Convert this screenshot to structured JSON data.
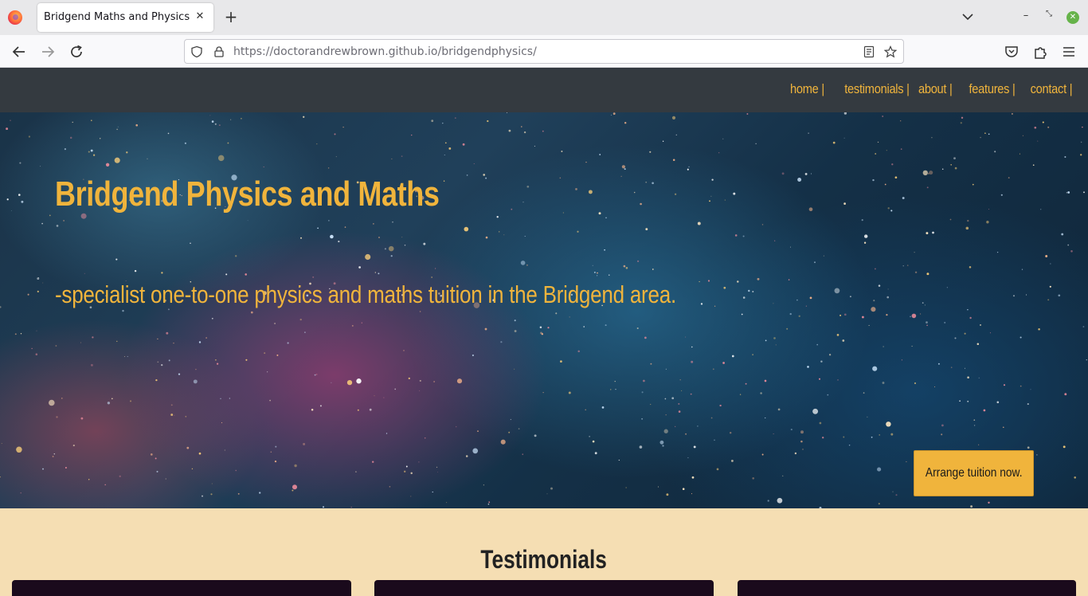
{
  "browser": {
    "tab_title": "Bridgend Maths and Physics",
    "url_host": "https://doctorandrewbrown.github.io",
    "url_path": "/bridgendphysics/",
    "icons": [
      "firefox-logo",
      "close-icon",
      "plus-icon",
      "chevron-down-icon",
      "minimize-icon",
      "restore-icon",
      "window-close-icon",
      "back-arrow-icon",
      "forward-arrow-icon",
      "reload-icon",
      "shield-icon",
      "lock-icon",
      "reader-view-icon",
      "bookmark-star-icon",
      "pocket-icon",
      "extensions-icon",
      "menu-icon"
    ]
  },
  "site_nav": {
    "items": [
      {
        "label": "home |"
      },
      {
        "label": "testimonials |"
      },
      {
        "label": "about |"
      },
      {
        "label": "features |"
      },
      {
        "label": "contact |"
      }
    ]
  },
  "hero": {
    "title": "Bridgend Physics and Maths",
    "subtitle": "-specialist one-to-one physics and maths tuition in the Bridgend area.",
    "cta_label": "Arrange tuition now."
  },
  "testimonials": {
    "heading": "Testimonials"
  },
  "colors": {
    "accent": "#f0b43c",
    "nav_bg": "#343a40",
    "section_bg": "#f5deb3",
    "card_bg": "#1a0a1c"
  }
}
